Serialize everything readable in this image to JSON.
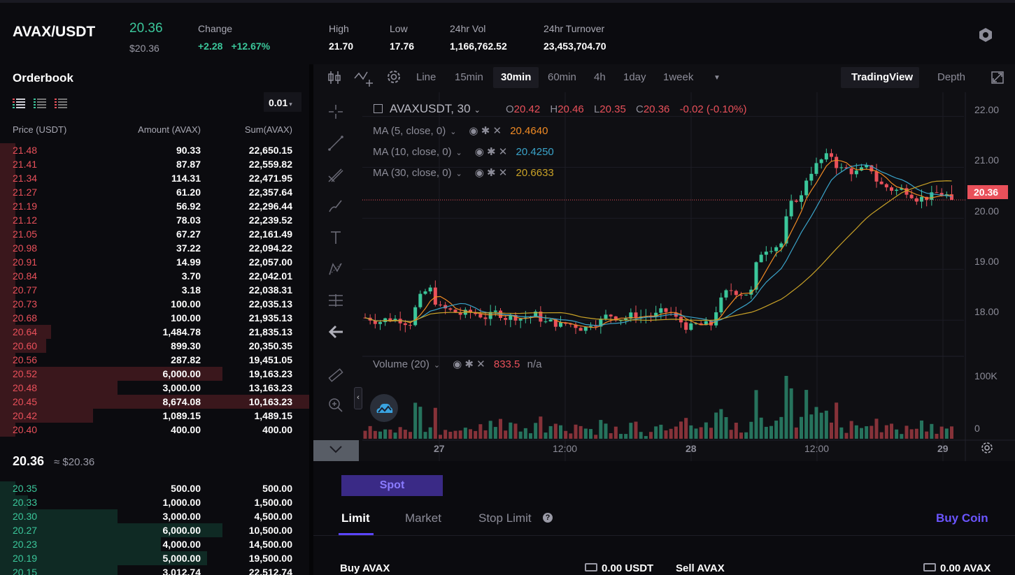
{
  "ticker": {
    "pair": "AVAX/USDT",
    "last_price": "20.36",
    "last_price_usd": "$20.36",
    "change_label": "Change",
    "change_abs": "+2.28",
    "change_pct": "+12.67%",
    "high_label": "High",
    "high": "21.70",
    "low_label": "Low",
    "low": "17.76",
    "vol_label": "24hr Vol",
    "vol": "1,166,762.52",
    "turnover_label": "24hr Turnover",
    "turnover": "23,453,704.70",
    "settings_icon": "hexagon-settings-icon"
  },
  "orderbook": {
    "title": "Orderbook",
    "precision": "0.01",
    "col_price": "Price (USDT)",
    "col_amount": "Amount (AVAX)",
    "col_sum": "Sum(AVAX)",
    "asks": [
      {
        "price": "21.48",
        "amount": "90.33",
        "sum": "22,650.15",
        "depth": 0.05
      },
      {
        "price": "21.41",
        "amount": "87.87",
        "sum": "22,559.82",
        "depth": 0.05
      },
      {
        "price": "21.34",
        "amount": "114.31",
        "sum": "22,471.95",
        "depth": 0.05
      },
      {
        "price": "21.27",
        "amount": "61.20",
        "sum": "22,357.64",
        "depth": 0.05
      },
      {
        "price": "21.19",
        "amount": "56.92",
        "sum": "22,296.44",
        "depth": 0.05
      },
      {
        "price": "21.12",
        "amount": "78.03",
        "sum": "22,239.52",
        "depth": 0.05
      },
      {
        "price": "21.05",
        "amount": "67.27",
        "sum": "22,161.49",
        "depth": 0.05
      },
      {
        "price": "20.98",
        "amount": "37.22",
        "sum": "22,094.22",
        "depth": 0.05
      },
      {
        "price": "20.91",
        "amount": "14.99",
        "sum": "22,057.00",
        "depth": 0.05
      },
      {
        "price": "20.84",
        "amount": "3.70",
        "sum": "22,042.01",
        "depth": 0.05
      },
      {
        "price": "20.77",
        "amount": "3.18",
        "sum": "22,038.31",
        "depth": 0.05
      },
      {
        "price": "20.73",
        "amount": "100.00",
        "sum": "22,035.13",
        "depth": 0.05
      },
      {
        "price": "20.68",
        "amount": "100.00",
        "sum": "21,935.13",
        "depth": 0.05
      },
      {
        "price": "20.64",
        "amount": "1,484.78",
        "sum": "21,835.13",
        "depth": 0.165
      },
      {
        "price": "20.60",
        "amount": "899.30",
        "sum": "20,350.35",
        "depth": 0.15
      },
      {
        "price": "20.56",
        "amount": "287.82",
        "sum": "19,451.05",
        "depth": 0.05
      },
      {
        "price": "20.52",
        "amount": "6,000.00",
        "sum": "19,163.23",
        "depth": 0.72
      },
      {
        "price": "20.48",
        "amount": "3,000.00",
        "sum": "13,163.23",
        "depth": 0.38
      },
      {
        "price": "20.45",
        "amount": "8,674.08",
        "sum": "10,163.23",
        "depth": 1.0
      },
      {
        "price": "20.42",
        "amount": "1,089.15",
        "sum": "1,489.15",
        "depth": 0.3
      },
      {
        "price": "20.40",
        "amount": "400.00",
        "sum": "400.00",
        "depth": 0.05
      }
    ],
    "mid_price": "20.36",
    "mid_usd": "≈ $20.36",
    "bids": [
      {
        "price": "20.35",
        "amount": "500.00",
        "sum": "500.00",
        "depth": 0.04
      },
      {
        "price": "20.33",
        "amount": "1,000.00",
        "sum": "1,500.00",
        "depth": 0.09
      },
      {
        "price": "20.30",
        "amount": "3,000.00",
        "sum": "4,500.00",
        "depth": 0.38
      },
      {
        "price": "20.27",
        "amount": "6,000.00",
        "sum": "10,500.00",
        "depth": 0.72
      },
      {
        "price": "20.23",
        "amount": "4,000.00",
        "sum": "14,500.00",
        "depth": 0.52
      },
      {
        "price": "20.19",
        "amount": "5,000.00",
        "sum": "19,500.00",
        "depth": 0.67
      },
      {
        "price": "20.15",
        "amount": "3,012.74",
        "sum": "22,512.74",
        "depth": 0.38
      }
    ]
  },
  "chart_toolbar": {
    "intervals": [
      "Line",
      "15min",
      "30min",
      "60min",
      "4h",
      "1day",
      "1week"
    ],
    "active_interval": "30min",
    "more_icon": "caret-down-icon",
    "view_tradingview": "TradingView",
    "view_depth": "Depth"
  },
  "chart_legend": {
    "symbol": "AVAXUSDT, 30",
    "o_label": "O",
    "o": "20.42",
    "h_label": "H",
    "h": "20.46",
    "l_label": "L",
    "l": "20.35",
    "c_label": "C",
    "c": "20.36",
    "chg": "-0.02 (-0.10%)",
    "ma5_label": "MA (5, close, 0)",
    "ma5": "20.4640",
    "ma10_label": "MA (10, close, 0)",
    "ma10": "20.4250",
    "ma30_label": "MA (30, close, 0)",
    "ma30": "20.6633",
    "vol_label": "Volume (20)",
    "vol": "833.5",
    "vol_na": "n/a",
    "price_tag": "20.36"
  },
  "chart_axes": {
    "y_ticks": [
      "22.00",
      "21.00",
      "20.00",
      "19.00",
      "18.00"
    ],
    "vol_ticks": [
      "100K",
      "0"
    ],
    "x_ticks": [
      "27",
      "12:00",
      "28",
      "12:00",
      "29"
    ]
  },
  "colors": {
    "up": "#3bc79b",
    "down": "#e9505a",
    "ma5": "#f08a24",
    "ma10": "#3aa3c9",
    "ma30": "#c9a227",
    "accent": "#5b45ff"
  },
  "order_form": {
    "spot": "Spot",
    "tabs": [
      "Limit",
      "Market",
      "Stop Limit"
    ],
    "active_tab": "Limit",
    "buy_coin": "Buy Coin",
    "buy_label": "Buy AVAX",
    "buy_balance": "0.00 USDT",
    "sell_label": "Sell AVAX",
    "sell_balance": "0.00 AVAX"
  }
}
